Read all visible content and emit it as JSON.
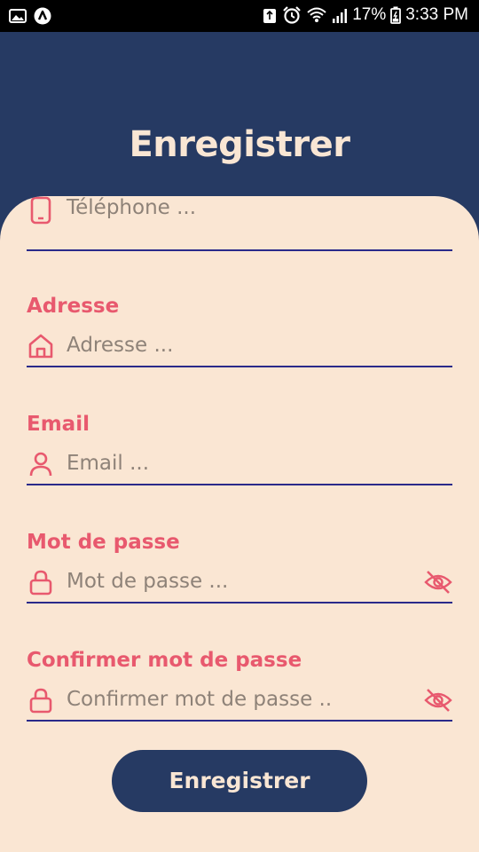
{
  "status_bar": {
    "battery": "17%",
    "time": "3:33 PM",
    "icons": [
      "gallery-icon",
      "app-notification-icon",
      "recycle-icon",
      "alarm-icon",
      "wifi-icon",
      "signal-icon",
      "battery-icon"
    ]
  },
  "header": {
    "title": "Enregistrer"
  },
  "form": {
    "phone": {
      "placeholder": "Téléphone ..."
    },
    "address": {
      "label": "Adresse",
      "placeholder": "Adresse ..."
    },
    "email": {
      "label": "Email",
      "placeholder": "Email ..."
    },
    "password": {
      "label": "Mot de passe",
      "placeholder": "Mot de passe ..."
    },
    "confirm_password": {
      "label": "Confirmer mot de passe",
      "placeholder": "Confirmer mot de passe .."
    },
    "submit_label": "Enregistrer"
  },
  "colors": {
    "primary": "#263A63",
    "background": "#FAE6D3",
    "accent": "#E8596E",
    "underline": "#2A2A8A"
  }
}
